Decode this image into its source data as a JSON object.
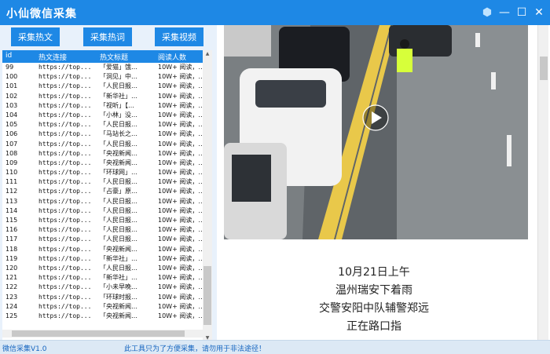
{
  "app": {
    "title": "小仙微信采集"
  },
  "window_controls": [
    "skin-icon",
    "minimize-icon",
    "maximize-icon",
    "close-icon"
  ],
  "toolbar": {
    "btn_articles": "采集热文",
    "btn_hotwords": "采集热词",
    "btn_videos": "采集视频"
  },
  "table": {
    "headers": {
      "id": "id",
      "url": "热文连接",
      "title": "热文标题",
      "reads": "阅读人数"
    },
    "rows": [
      {
        "id": "99",
        "url": "https://top...",
        "title": "「爱猫」饿…",
        "reads": "10W+ 阅读，…"
      },
      {
        "id": "100",
        "url": "https://top...",
        "title": "「洞见」中…",
        "reads": "10W+ 阅读，…"
      },
      {
        "id": "101",
        "url": "https://top...",
        "title": "「人民日报…",
        "reads": "10W+ 阅读，…"
      },
      {
        "id": "102",
        "url": "https://top...",
        "title": "「新华社」…",
        "reads": "10W+ 阅读，…"
      },
      {
        "id": "103",
        "url": "https://top...",
        "title": "「视听」【…",
        "reads": "10W+ 阅读，…"
      },
      {
        "id": "104",
        "url": "https://top...",
        "title": "「小林」没…",
        "reads": "10W+ 阅读，…"
      },
      {
        "id": "105",
        "url": "https://top...",
        "title": "「人民日报…",
        "reads": "10W+ 阅读，…"
      },
      {
        "id": "106",
        "url": "https://top...",
        "title": "「马站长之…",
        "reads": "10W+ 阅读，…"
      },
      {
        "id": "107",
        "url": "https://top...",
        "title": "「人民日报…",
        "reads": "10W+ 阅读，…"
      },
      {
        "id": "108",
        "url": "https://top...",
        "title": "「央视新闻…",
        "reads": "10W+ 阅读，…"
      },
      {
        "id": "109",
        "url": "https://top...",
        "title": "「央视新闻…",
        "reads": "10W+ 阅读，…"
      },
      {
        "id": "110",
        "url": "https://top...",
        "title": "「环球网」…",
        "reads": "10W+ 阅读，…"
      },
      {
        "id": "111",
        "url": "https://top...",
        "title": "「人民日报…",
        "reads": "10W+ 阅读，…"
      },
      {
        "id": "112",
        "url": "https://top...",
        "title": "「占豪」原…",
        "reads": "10W+ 阅读，…"
      },
      {
        "id": "113",
        "url": "https://top...",
        "title": "「人民日报…",
        "reads": "10W+ 阅读，…"
      },
      {
        "id": "114",
        "url": "https://top...",
        "title": "「人民日报…",
        "reads": "10W+ 阅读，…"
      },
      {
        "id": "115",
        "url": "https://top...",
        "title": "「人民日报…",
        "reads": "10W+ 阅读，…"
      },
      {
        "id": "116",
        "url": "https://top...",
        "title": "「人民日报…",
        "reads": "10W+ 阅读，…"
      },
      {
        "id": "117",
        "url": "https://top...",
        "title": "「人民日报…",
        "reads": "10W+ 阅读，…"
      },
      {
        "id": "118",
        "url": "https://top...",
        "title": "「央视新闻…",
        "reads": "10W+ 阅读，…"
      },
      {
        "id": "119",
        "url": "https://top...",
        "title": "「新华社」…",
        "reads": "10W+ 阅读，…"
      },
      {
        "id": "120",
        "url": "https://top...",
        "title": "「人民日报…",
        "reads": "10W+ 阅读，…"
      },
      {
        "id": "121",
        "url": "https://top...",
        "title": "「新华社」…",
        "reads": "10W+ 阅读，…"
      },
      {
        "id": "122",
        "url": "https://top...",
        "title": "「小未早晚…",
        "reads": "10W+ 阅读，…"
      },
      {
        "id": "123",
        "url": "https://top...",
        "title": "「环球时报…",
        "reads": "10W+ 阅读，…"
      },
      {
        "id": "124",
        "url": "https://top...",
        "title": "「央视新闻…",
        "reads": "10W+ 阅读，…"
      },
      {
        "id": "125",
        "url": "https://top...",
        "title": "「央视新闻…",
        "reads": "10W+ 阅读，…"
      }
    ]
  },
  "video": {
    "play_icon": "play-icon"
  },
  "article": {
    "lines": [
      "10月21日上午",
      "温州瑞安下着雨",
      "交警安阳中队辅警郑远",
      "正在路口指"
    ]
  },
  "status": {
    "left": "微信采集V1.0",
    "message": "此工具只为了方便采集，请勿用于非法途径！"
  },
  "colors": {
    "accent": "#1e88e5",
    "panel": "#e8f1fb",
    "status_text": "#1565c0"
  }
}
